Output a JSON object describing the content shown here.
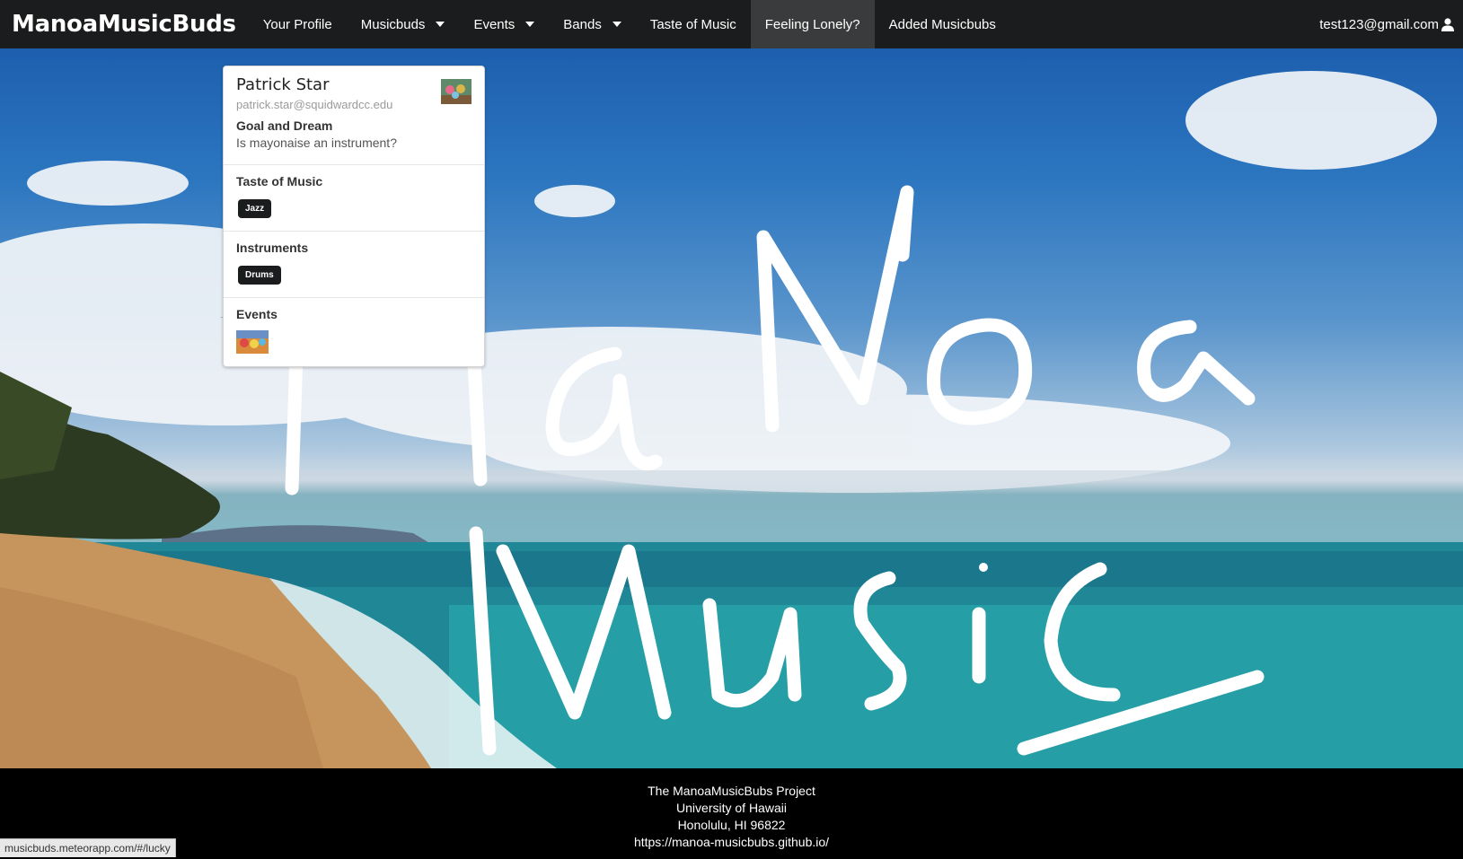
{
  "navbar": {
    "brand": "ManoaMusicBuds",
    "items": [
      {
        "label": "Your Profile",
        "dropdown": false
      },
      {
        "label": "Musicbuds",
        "dropdown": true
      },
      {
        "label": "Events",
        "dropdown": true
      },
      {
        "label": "Bands",
        "dropdown": true
      },
      {
        "label": "Taste of Music",
        "dropdown": false
      },
      {
        "label": "Feeling Lonely?",
        "dropdown": false,
        "active": true
      },
      {
        "label": "Added Musicbubs",
        "dropdown": false
      }
    ],
    "user": "test123@gmail.com"
  },
  "hero": {
    "handwritten_lines": [
      "MaNoa",
      "Music"
    ]
  },
  "card": {
    "name": "Patrick Star",
    "email": "patrick.star@squidwardcc.edu",
    "goal_label": "Goal and Dream",
    "goal": "Is mayonaise an instrument?",
    "taste_label": "Taste of Music",
    "taste_tag": "Jazz",
    "instruments_label": "Instruments",
    "instrument_tag": "Drums",
    "events_label": "Events"
  },
  "footer": {
    "line1": "The ManoaMusicBubs Project",
    "line2": "University of Hawaii",
    "line3": "Honolulu, HI 96822",
    "line4": "https://manoa-musicbubs.github.io/"
  },
  "status_url": "musicbuds.meteorapp.com/#/lucky",
  "colors": {
    "navbar": "#1b1c1d",
    "active_nav": "#3a3b3c",
    "tag": "#1b1c1d",
    "footer": "#000000"
  }
}
